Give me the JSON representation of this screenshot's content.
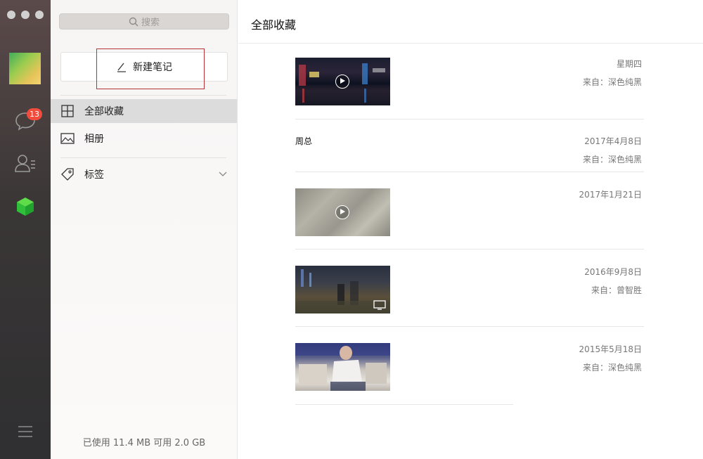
{
  "rail": {
    "badge_count": "13",
    "colors": {
      "badge": "#f24c3d",
      "active_app": "#2fbf3a"
    }
  },
  "sidebar": {
    "search_placeholder": "搜索",
    "new_note_label": "新建笔记",
    "items": [
      {
        "label": "全部收藏",
        "icon": "grid-icon",
        "active": true
      },
      {
        "label": "相册",
        "icon": "image-icon",
        "active": false
      },
      {
        "label": "标签",
        "icon": "tag-icon",
        "active": false
      }
    ],
    "storage": "已使用 11.4 MB 可用 2.0 GB"
  },
  "main": {
    "title": "全部收藏",
    "entries": [
      {
        "type": "video",
        "date": "星期四",
        "source": "来自：深色纯黑"
      },
      {
        "type": "text",
        "text": "周总",
        "date": "2017年4月8日",
        "source": "来自：深色纯黑"
      },
      {
        "type": "video",
        "date": "2017年1月21日",
        "source": ""
      },
      {
        "type": "screen",
        "date": "2016年9月8日",
        "source": "来自：曾智胜"
      },
      {
        "type": "image",
        "date": "2015年5月18日",
        "source": "来自：深色纯黑"
      }
    ]
  }
}
